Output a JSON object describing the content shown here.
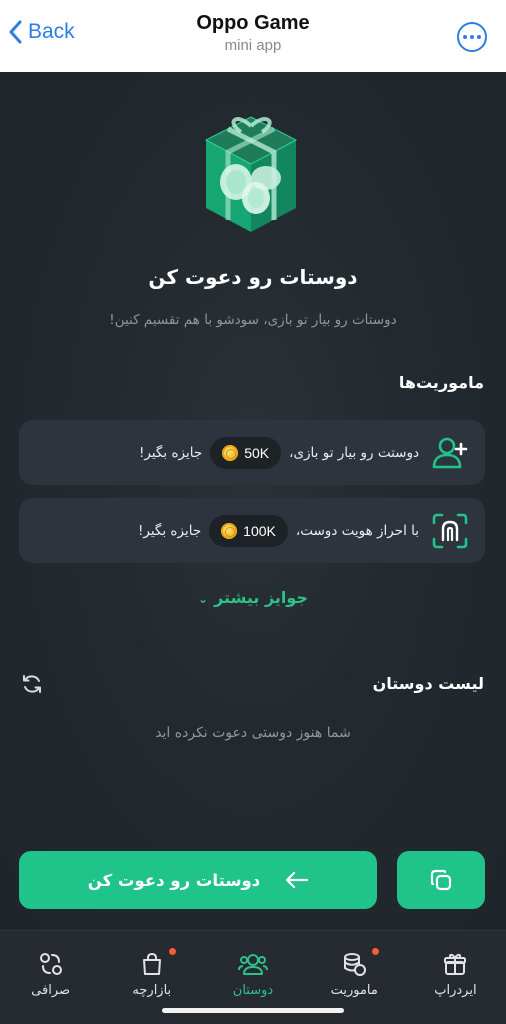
{
  "header": {
    "back_label": "Back",
    "title": "Oppo Game",
    "subtitle": "mini app",
    "back_icon": "chevron-left-icon",
    "more_icon": "more-dots-icon"
  },
  "hero": {
    "icon": "gift-box-icon",
    "headline": "دوستات رو دعوت کن",
    "subline": "دوستات رو بیار تو بازی، سودشو با هم تقسیم کنین!"
  },
  "missions": {
    "title": "ماموریت‌ها",
    "items": [
      {
        "icon": "user-plus-icon",
        "text": "دوستت رو بیار تو بازی،",
        "reward": "50K",
        "suffix": "جایزه بگیر!"
      },
      {
        "icon": "face-id-icon",
        "text": "با احراز هویت دوست،",
        "reward": "100K",
        "suffix": "جایزه بگیر!"
      }
    ],
    "more_label": "جوایز بیشتر"
  },
  "friends": {
    "title": "لیست دوستان",
    "empty_text": "شما هنوز دوستی دعوت نکرده اید",
    "refresh_icon": "refresh-icon"
  },
  "actions": {
    "invite_label": "دوستات رو دعوت کن",
    "invite_icon": "arrow-left-icon",
    "copy_icon": "copy-icon"
  },
  "nav": {
    "items": [
      {
        "label": "ایردراپ",
        "icon": "gift-icon",
        "badge": false,
        "active": false
      },
      {
        "label": "ماموریت",
        "icon": "coins-stack-icon",
        "badge": true,
        "active": false
      },
      {
        "label": "دوستان",
        "icon": "users-icon",
        "badge": false,
        "active": true
      },
      {
        "label": "بازارچه",
        "icon": "shopping-bag-icon",
        "badge": true,
        "active": false
      },
      {
        "label": "صرافی",
        "icon": "exchange-icon",
        "badge": false,
        "active": false
      }
    ]
  },
  "colors": {
    "accent": "#20c38a",
    "background": "#1f262c",
    "card": "#2d343d",
    "badge": "#ff5a36",
    "link": "#2e7de6"
  }
}
